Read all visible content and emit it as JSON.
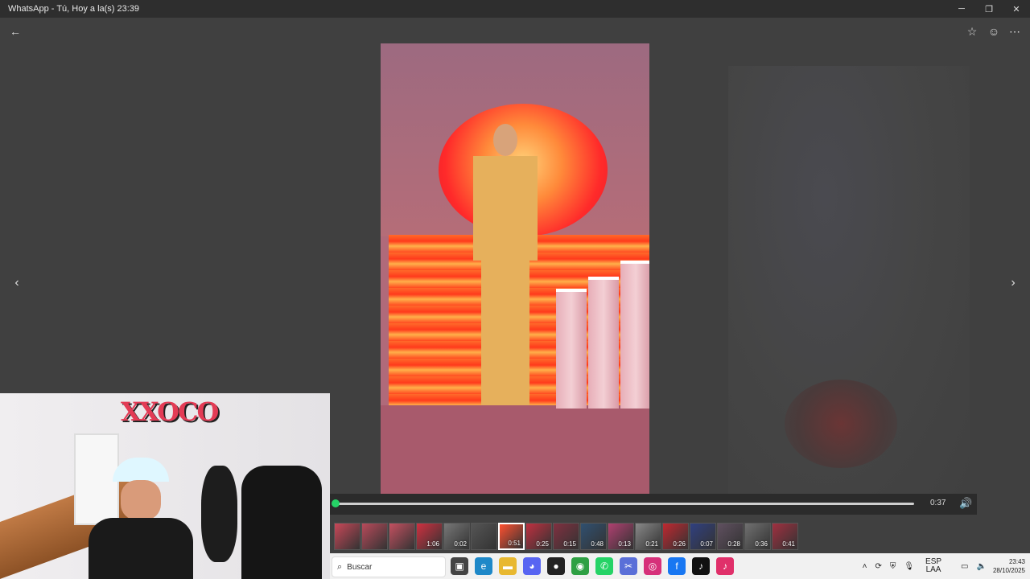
{
  "window": {
    "title": "WhatsApp - Tú, Hoy a la(s) 23:39"
  },
  "viewer": {
    "current_time": "0:37",
    "progress": 0.0
  },
  "thumbnails": [
    {
      "duration": "",
      "color": "#c84858"
    },
    {
      "duration": "",
      "color": "#b84a5a"
    },
    {
      "duration": "",
      "color": "#c45060"
    },
    {
      "duration": "1:06",
      "color": "#d03040"
    },
    {
      "duration": "0:02",
      "color": "#777777"
    },
    {
      "duration": "",
      "color": "#555555"
    },
    {
      "duration": "0:51",
      "color": "#ff5030",
      "active": true
    },
    {
      "duration": "0:25",
      "color": "#c03040"
    },
    {
      "duration": "0:15",
      "color": "#803040"
    },
    {
      "duration": "0:48",
      "color": "#305070"
    },
    {
      "duration": "0:13",
      "color": "#b04070"
    },
    {
      "duration": "0:21",
      "color": "#888888"
    },
    {
      "duration": "0:26",
      "color": "#c02830"
    },
    {
      "duration": "0:07",
      "color": "#304080"
    },
    {
      "duration": "0:28",
      "color": "#605060"
    },
    {
      "duration": "0:36",
      "color": "#707070"
    },
    {
      "duration": "0:41",
      "color": "#a03040"
    }
  ],
  "taskbar": {
    "search_placeholder": "Buscar",
    "language": "ESP",
    "layout": "LAA",
    "time": "23:43",
    "date": "28/10/2025"
  },
  "taskbar_apps": [
    {
      "name": "task-view-icon",
      "glyph": "▣",
      "color": "#444444"
    },
    {
      "name": "edge-icon",
      "glyph": "e",
      "color": "#1e88c8"
    },
    {
      "name": "file-explorer-icon",
      "glyph": "▬",
      "color": "#e8b830"
    },
    {
      "name": "discord-icon",
      "glyph": "◕",
      "color": "#5865f2"
    },
    {
      "name": "obs-icon",
      "glyph": "●",
      "color": "#222222"
    },
    {
      "name": "chrome-icon",
      "glyph": "◉",
      "color": "#2ea043"
    },
    {
      "name": "whatsapp-icon",
      "glyph": "✆",
      "color": "#25d366"
    },
    {
      "name": "snipping-tool-icon",
      "glyph": "✂",
      "color": "#5a6fd8"
    },
    {
      "name": "instagram-icon",
      "glyph": "◎",
      "color": "#d6307a"
    },
    {
      "name": "facebook-icon",
      "glyph": "f",
      "color": "#1877f2"
    },
    {
      "name": "tiktok-icon",
      "glyph": "♪",
      "color": "#111111"
    },
    {
      "name": "tiktok-live-icon",
      "glyph": "♪",
      "color": "#e0306a"
    }
  ]
}
